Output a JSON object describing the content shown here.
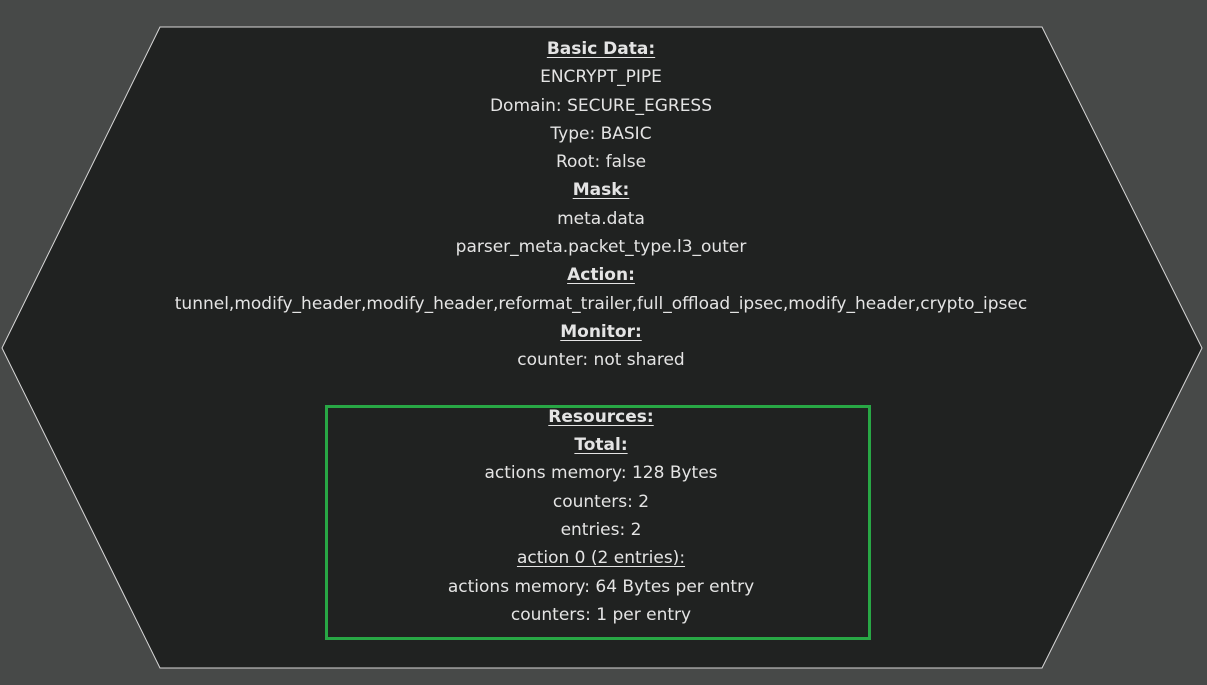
{
  "node": {
    "basic_heading": "Basic Data:",
    "name": "ENCRYPT_PIPE",
    "domain": "Domain: SECURE_EGRESS",
    "type": "Type: BASIC",
    "root": "Root: false",
    "mask_heading": "Mask:",
    "mask_items": [
      "meta.data",
      "parser_meta.packet_type.l3_outer"
    ],
    "action_heading": "Action:",
    "actions": "tunnel,modify_header,modify_header,reformat_trailer,full_offload_ipsec,modify_header,crypto_ipsec",
    "monitor_heading": "Monitor:",
    "monitor_counter": "counter: not shared"
  },
  "resources": {
    "heading": "Resources:",
    "total_heading": "Total:",
    "total_actions_memory": "actions memory: 128 Bytes",
    "total_counters": "counters: 2",
    "total_entries": "entries: 2",
    "action0_heading": "action 0 (2 entries):",
    "action0_memory": "actions memory: 64 Bytes per entry",
    "action0_counters": "counters: 1 per entry"
  },
  "colors": {
    "background": "#474948",
    "node_fill": "#202221",
    "node_border": "#d8d8d8",
    "text": "#e4e4e4",
    "highlight_border": "#28a745"
  }
}
